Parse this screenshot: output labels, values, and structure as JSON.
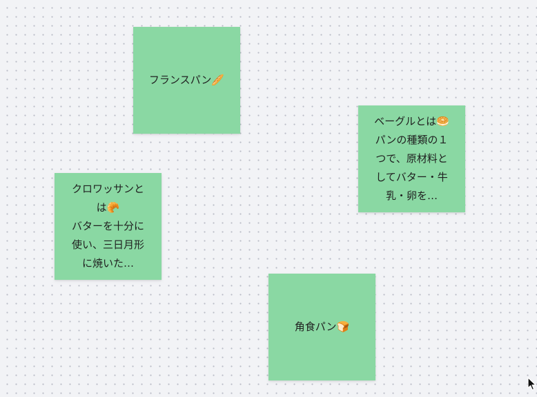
{
  "board": {
    "notes": [
      {
        "text": "フランスパン🥖"
      },
      {
        "text": "ベーグルとは🥯\nパンの種類の１\nつで、原材料と\nしてバター・牛\n乳・卵を…"
      },
      {
        "text": "クロワッサンと\nは🥐\nバターを十分に\n使い、三日月形\nに焼いた…"
      },
      {
        "text": "角食パン🍞"
      }
    ]
  },
  "colors": {
    "canvas_background": "#f2f3f6",
    "grid_dot": "#b9bcc6",
    "sticky_note": "#8ad8a3",
    "text": "#1f1f1f"
  },
  "icons": {
    "cursor": "arrow-cursor-icon"
  }
}
